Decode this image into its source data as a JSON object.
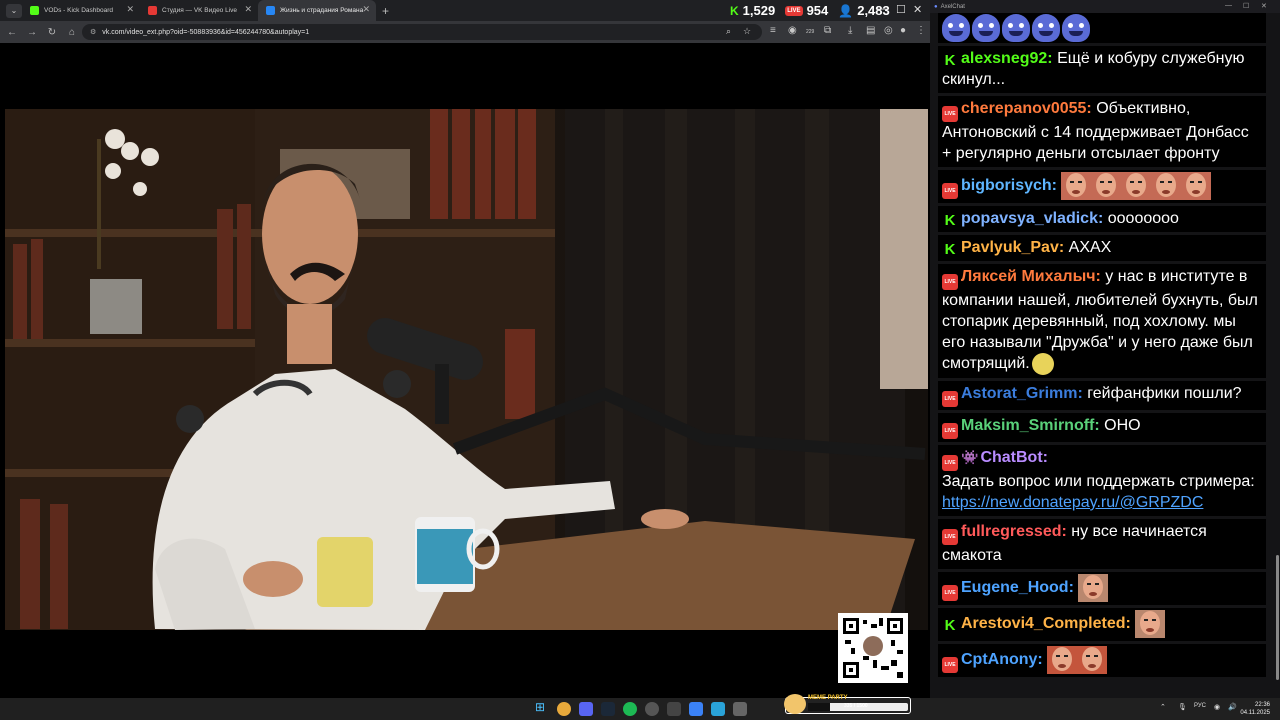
{
  "browser": {
    "tabs": [
      {
        "label": "VODs - Kick Dashboard",
        "color": "#53fc18",
        "active": false
      },
      {
        "label": "Студия — VK Видео Live",
        "color": "#e53935",
        "active": false
      },
      {
        "label": "Жизнь и страдания Романа",
        "color": "#2787f5",
        "active": true
      }
    ],
    "new_tab": "+",
    "url": "vk.com/video_ext.php?oid=-50883936&id=456244780&autoplay=1",
    "stats": {
      "kick_viewers": "1,529",
      "vk_live_label": "LIVE",
      "vk_viewers": "954",
      "total_viewers": "2,483"
    },
    "extension_badge": "229"
  },
  "chat": {
    "window_title": "AxelChat",
    "messages": [
      {
        "kind": "emotes"
      },
      {
        "platform": "kick",
        "user": "alexsneg92:",
        "color": "#53fc18",
        "text": "Ещё и кобуру служебную скинул..."
      },
      {
        "platform": "vk",
        "user": "cherepanov0055:",
        "color": "#ff7a3d",
        "text": "Объективно, Антоновский с 14 поддерживает Донбасс + регулярно деньги отсылает фронту"
      },
      {
        "platform": "vk",
        "user": "bigborisych:",
        "color": "#5fb6ff",
        "text": ""
      },
      {
        "platform": "kick",
        "user": "popavsya_vladick:",
        "color": "#7fb2ff",
        "text": "оооооооо"
      },
      {
        "platform": "kick",
        "user": "Pavlyuk_Pav:",
        "color": "#ffb347",
        "text": "АХАХ"
      },
      {
        "platform": "vk",
        "user": "Ляксей Михалыч:",
        "color": "#ff7a3d",
        "text": "у нас в институте в компании нашей, любителей бухнуть, был стопарик деревянный, под хохлому. мы его называли \"Дружба\" и у него даже был смотрящий."
      },
      {
        "platform": "vk",
        "user": "Astorat_Grimm:",
        "color": "#3b7ddd",
        "text": "гейфанфики пошли?"
      },
      {
        "platform": "vk",
        "user": "Maksim_Smirnoff:",
        "color": "#5ad17a",
        "text": "ОНО"
      },
      {
        "platform": "vk",
        "user": "ChatBot:",
        "color": "#b98cff",
        "text": "Задать вопрос или поддержать стримера:",
        "link": "https://new.donatepay.ru/@GRPZDC"
      },
      {
        "platform": "vk",
        "user": "fullregressed:",
        "color": "#ff5a5a",
        "text": "ну все начинается смакота"
      },
      {
        "platform": "vk",
        "user": "Eugene_Hood:",
        "color": "#4ea3ff",
        "text": ""
      },
      {
        "platform": "kick",
        "user": "Arestovi4_Completed:",
        "color": "#ffb347",
        "text": ""
      },
      {
        "platform": "vk",
        "user": "CptAnony:",
        "color": "#4ea3ff",
        "text": ""
      }
    ]
  },
  "taskbar": {
    "lang": "РУС",
    "time": "22:36",
    "date": "04.11.2025",
    "meme_party": {
      "title": "MEME PARTY",
      "value": "335 / 1500",
      "progress": 0.22
    }
  },
  "colors": {
    "kick": "#53fc18",
    "vk_live": "#e53935",
    "chat_bg": "#000000"
  }
}
